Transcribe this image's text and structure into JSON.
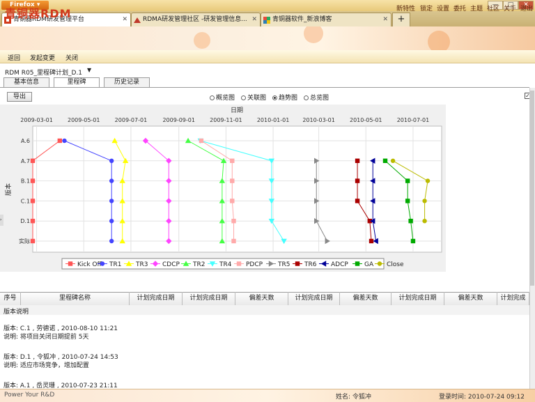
{
  "window": {
    "app_button": "Firefox",
    "min": "—",
    "max": "□",
    "close": "✕"
  },
  "tabs": [
    {
      "title": "青铜器RDM研发管理平台",
      "close": "✕"
    },
    {
      "title": "RDMA研发管理社区 -研发管理信息...",
      "close": "✕"
    },
    {
      "title": "青铜器软件_新浪博客",
      "close": "✕"
    }
  ],
  "new_tab": "+",
  "header": {
    "logo": "青铜器RDM",
    "links": [
      "新特性",
      "锁定",
      "设置",
      "委托",
      "主题",
      "社区",
      "关于",
      "退出"
    ]
  },
  "menu": [
    "返回",
    "发起变更",
    "关闭"
  ],
  "breadcrumb": "RDM R05_里程碑计划_D.1",
  "breadcrumb_arrow": "▼",
  "subtabs": [
    "基本信息",
    "里程碑",
    "历史记录"
  ],
  "toolbar": {
    "export": "导出",
    "radios": [
      {
        "label": "概览图",
        "checked": false
      },
      {
        "label": "关联图",
        "checked": false
      },
      {
        "label": "趋势图",
        "checked": true
      },
      {
        "label": "总览图",
        "checked": false
      }
    ],
    "checkbox_mark": "✓"
  },
  "chart_data": {
    "type": "line",
    "xlabel": "日期",
    "ylabel": "版本",
    "x_ticks": [
      "2009-03-01",
      "2009-05-01",
      "2009-07-01",
      "2009-09-01",
      "2009-11-01",
      "2010-01-01",
      "2010-03-01",
      "2010-05-01",
      "2010-07-01"
    ],
    "y_categories": [
      "A.6",
      "A.7",
      "B.1",
      "C.1",
      "D.1",
      "实际"
    ],
    "series": [
      {
        "name": "Kick Off",
        "color": "#ff5555",
        "marker": "square",
        "points": [
          [
            "2009-03-31",
            "A.6"
          ],
          [
            "2009-02-24",
            "A.7"
          ],
          [
            "2009-02-24",
            "B.1"
          ],
          [
            "2009-02-24",
            "C.1"
          ],
          [
            "2009-02-24",
            "D.1"
          ],
          [
            "2009-02-24",
            "实际"
          ]
        ]
      },
      {
        "name": "TR1",
        "color": "#4444ff",
        "marker": "circle",
        "points": [
          [
            "2009-04-06",
            "A.6"
          ],
          [
            "2009-06-06",
            "A.7"
          ],
          [
            "2009-06-06",
            "B.1"
          ],
          [
            "2009-06-06",
            "C.1"
          ],
          [
            "2009-06-06",
            "D.1"
          ],
          [
            "2009-06-06",
            "实际"
          ]
        ]
      },
      {
        "name": "TR3",
        "color": "#ffff00",
        "marker": "triangle",
        "points": [
          [
            "2009-06-10",
            "A.6"
          ],
          [
            "2009-06-24",
            "A.7"
          ],
          [
            "2009-06-20",
            "B.1"
          ],
          [
            "2009-06-20",
            "C.1"
          ],
          [
            "2009-06-20",
            "D.1"
          ],
          [
            "2009-06-20",
            "实际"
          ]
        ]
      },
      {
        "name": "CDCP",
        "color": "#ff44ff",
        "marker": "diamond",
        "points": [
          [
            "2009-07-20",
            "A.6"
          ],
          [
            "2009-08-19",
            "A.7"
          ],
          [
            "2009-08-19",
            "B.1"
          ],
          [
            "2009-08-19",
            "C.1"
          ],
          [
            "2009-08-19",
            "D.1"
          ],
          [
            "2009-08-19",
            "实际"
          ]
        ]
      },
      {
        "name": "TR2",
        "color": "#44ff44",
        "marker": "triangle",
        "points": [
          [
            "2009-09-13",
            "A.6"
          ],
          [
            "2009-10-29",
            "A.7"
          ],
          [
            "2009-10-27",
            "B.1"
          ],
          [
            "2009-10-27",
            "C.1"
          ],
          [
            "2009-10-27",
            "D.1"
          ],
          [
            "2009-10-27",
            "实际"
          ]
        ]
      },
      {
        "name": "TR4",
        "color": "#44ffff",
        "marker": "triangle-down",
        "points": [
          [
            "2009-09-29",
            "A.6"
          ],
          [
            "2009-12-30",
            "A.7"
          ],
          [
            "2009-12-30",
            "B.1"
          ],
          [
            "2009-12-30",
            "C.1"
          ],
          [
            "2009-12-30",
            "D.1"
          ],
          [
            "2010-01-15",
            "实际"
          ]
        ]
      },
      {
        "name": "PDCP",
        "color": "#ffaaaa",
        "marker": "square",
        "points": [
          [
            "2009-09-30",
            "A.6"
          ],
          [
            "2009-11-09",
            "A.7"
          ],
          [
            "2009-11-09",
            "B.1"
          ],
          [
            "2009-11-09",
            "C.1"
          ],
          [
            "2009-11-11",
            "D.1"
          ],
          [
            "2009-11-11",
            "实际"
          ]
        ]
      },
      {
        "name": "TR5",
        "color": "#888888",
        "marker": "triangle-right",
        "points": [
          [
            "2010-02-26",
            "A.7"
          ],
          [
            "2010-02-26",
            "B.1"
          ],
          [
            "2010-02-26",
            "C.1"
          ],
          [
            "2010-02-26",
            "D.1"
          ],
          [
            "2010-03-12",
            "实际"
          ]
        ]
      },
      {
        "name": "TR6",
        "color": "#aa0000",
        "marker": "square",
        "points": [
          [
            "2010-04-20",
            "A.7"
          ],
          [
            "2010-04-20",
            "B.1"
          ],
          [
            "2010-04-20",
            "C.1"
          ],
          [
            "2010-05-06",
            "D.1"
          ],
          [
            "2010-05-08",
            "实际"
          ]
        ]
      },
      {
        "name": "ADCP",
        "color": "#000099",
        "marker": "triangle-left",
        "points": [
          [
            "2010-05-10",
            "A.7"
          ],
          [
            "2010-05-10",
            "B.1"
          ],
          [
            "2010-05-10",
            "C.1"
          ],
          [
            "2010-05-10",
            "D.1"
          ],
          [
            "2010-05-14",
            "实际"
          ]
        ]
      },
      {
        "name": "GA",
        "color": "#00aa00",
        "marker": "square",
        "points": [
          [
            "2010-05-26",
            "A.7"
          ],
          [
            "2010-06-24",
            "B.1"
          ],
          [
            "2010-06-24",
            "C.1"
          ],
          [
            "2010-06-28",
            "D.1"
          ],
          [
            "2010-07-01",
            "实际"
          ]
        ]
      },
      {
        "name": "Close",
        "color": "#bbbb00",
        "marker": "circle",
        "points": [
          [
            "2010-06-05",
            "A.7"
          ],
          [
            "2010-07-20",
            "B.1"
          ],
          [
            "2010-07-16",
            "C.1"
          ],
          [
            "2010-07-16",
            "D.1"
          ]
        ]
      }
    ],
    "grid": true,
    "legend_position": "bottom"
  },
  "grid_headers": [
    "序号",
    "里程碑名称",
    "计划完成日期",
    "计划完成日期",
    "偏差天数",
    "计划完成日期",
    "偏差天数",
    "计划完成日期",
    "偏差天数",
    "计划完成"
  ],
  "notes": {
    "title": "版本说明",
    "entries": [
      {
        "version": "版本: C.1 , 劳德诺 , 2010-08-10 11:21",
        "desc": "说明: 将项目关闭日期提前 5天"
      },
      {
        "version": "版本: D.1 , 令狐冲 , 2010-07-24 14:53",
        "desc": "说明: 适应市场竞争，增加配置"
      },
      {
        "version": "版本: A.1 , 岳灵珊 , 2010-07-23 21:11",
        "desc": ""
      }
    ]
  },
  "status": {
    "slogan": "Power Your R&D",
    "user": "姓名: 令狐冲",
    "login_time": "登录时间: 2010-07-24 09:12"
  }
}
